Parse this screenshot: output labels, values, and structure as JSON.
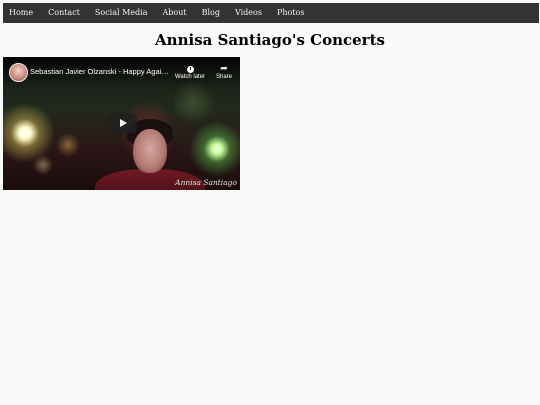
{
  "nav": {
    "items": [
      "Home",
      "Contact",
      "Social Media",
      "About",
      "Blog",
      "Videos",
      "Photos"
    ]
  },
  "page": {
    "title": "Annisa Santiago's Concerts"
  },
  "video": {
    "title": "Sebastian Javier Olzanski - Happy Again ...",
    "watch_later_label": "Watch later",
    "share_label": "Share",
    "watermark": "Annisa Santiago"
  },
  "icons": {
    "watch_later": "clock-icon",
    "share": "share-arrow-icon",
    "play": "play-icon"
  },
  "colors": {
    "nav_background": "#333333",
    "nav_text": "#f2f2f2",
    "page_background": "#fafafa"
  }
}
